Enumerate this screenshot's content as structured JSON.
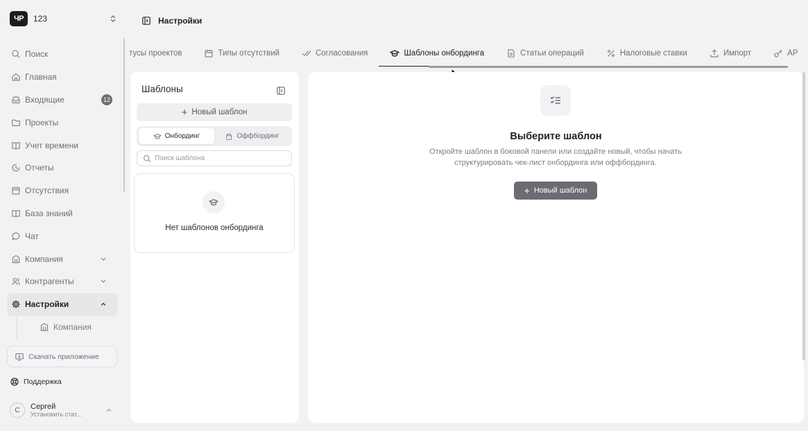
{
  "workspace": {
    "logo_text": "ЧР",
    "name": "123",
    "switch_icon": "chevron-updown-icon"
  },
  "header": {
    "toggle_icon": "sidebar-toggle-icon",
    "title": "Настройки"
  },
  "nav": {
    "search": "Поиск",
    "home": "Главная",
    "inbox": "Входящие",
    "inbox_count": "12",
    "projects": "Проекты",
    "time_tracking": "Учет времени",
    "reports": "Отчеты",
    "absences": "Отсутствия",
    "knowledge_base": "База знаний",
    "chat": "Чат",
    "company": "Компания",
    "contractors": "Контрагенты",
    "settings": "Настройки",
    "settings_sub_company": "Компания"
  },
  "download_app": "Скачать приложение",
  "support": "Поддержка",
  "user": {
    "initial": "С",
    "name": "Сергей",
    "status": "Установить стат..."
  },
  "tabs": [
    {
      "label": "тусы проектов",
      "icon": ""
    },
    {
      "label": "Типы отсутствий",
      "icon": "calendar-icon"
    },
    {
      "label": "Согласования",
      "icon": "double-check-icon"
    },
    {
      "label": "Шаблоны онбординга",
      "icon": "graduation-cap-icon"
    },
    {
      "label": "Статьи операций",
      "icon": "document-icon"
    },
    {
      "label": "Налоговые ставки",
      "icon": "percent-icon"
    },
    {
      "label": "Импорт",
      "icon": "upload-icon"
    },
    {
      "label": "AP",
      "icon": "key-icon"
    }
  ],
  "active_tab": "Шаблоны онбординга",
  "templates_panel": {
    "title": "Шаблоны",
    "new_template": "Новый шаблон",
    "segment_onboarding": "Онбординг",
    "segment_offboarding": "Оффбординг",
    "search_placeholder": "Поиск шаблона",
    "empty_text": "Нет шаблонов онбординга"
  },
  "main_panel": {
    "title": "Выберите шаблон",
    "description": "Откройте шаблон в боковой панели или создайте новый, чтобы начать структурировать чек-лист онбординга или оффбординга.",
    "new_template": "Новый шаблон"
  },
  "colors": {
    "accent_dark": "#1c1c21",
    "button_gray": "#6b6b72",
    "background": "#f2f2f3",
    "panel": "#ffffff"
  }
}
